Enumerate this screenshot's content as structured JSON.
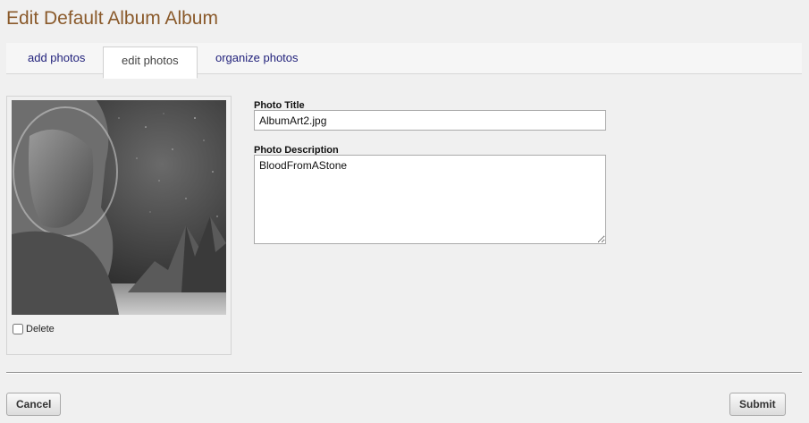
{
  "page": {
    "title": "Edit Default Album Album"
  },
  "tabs": [
    {
      "label": "add photos",
      "active": false
    },
    {
      "label": "edit photos",
      "active": true
    },
    {
      "label": "organize photos",
      "active": false
    }
  ],
  "photo": {
    "image_icon": "album-art-image",
    "delete_label": "Delete",
    "delete_checked": false
  },
  "form": {
    "title_label": "Photo Title",
    "title_value": "AlbumArt2.jpg",
    "description_label": "Photo Description",
    "description_value": "BloodFromAStone"
  },
  "actions": {
    "cancel_label": "Cancel",
    "submit_label": "Submit"
  },
  "colors": {
    "title": "#8a5a2b",
    "link": "#1f1f7a",
    "background": "#f0f0f0"
  }
}
